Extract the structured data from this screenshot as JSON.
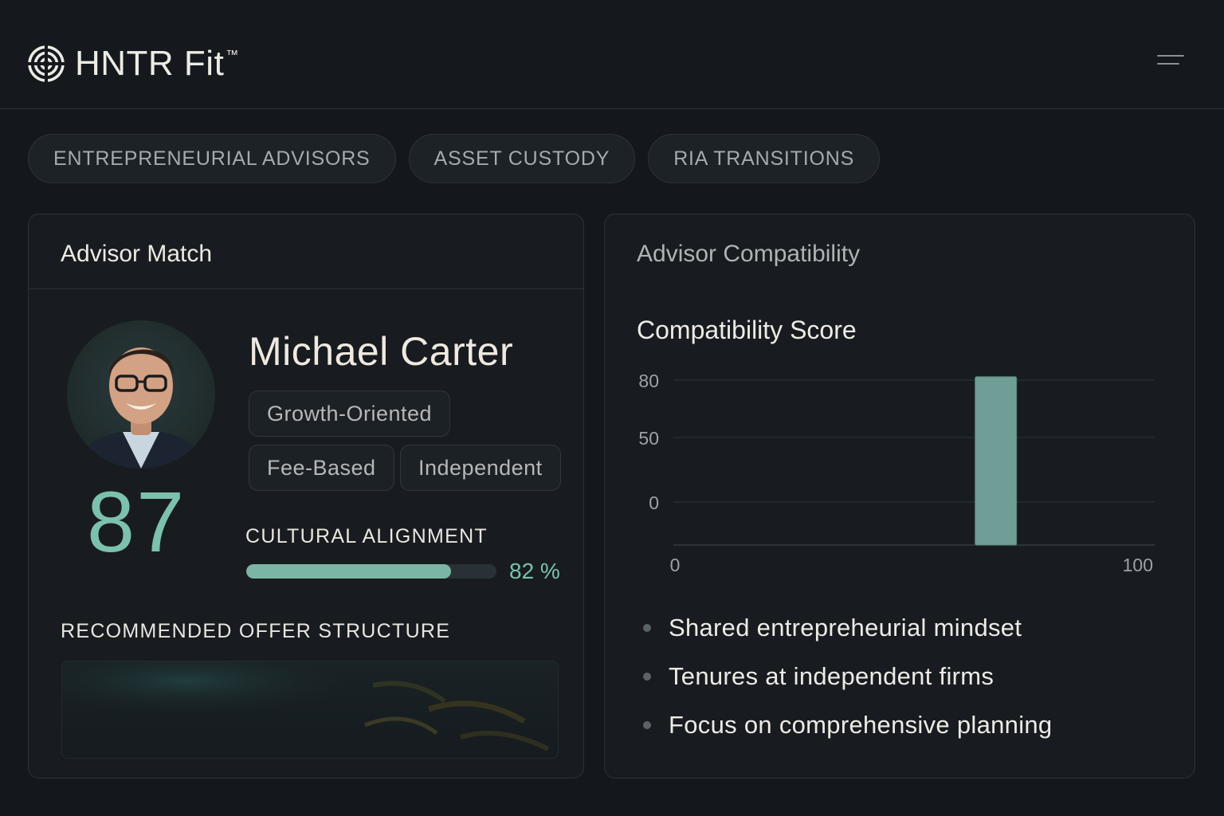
{
  "header": {
    "brand": "HNTR Fit",
    "trademark": "™",
    "logo_icon": "target-icon",
    "menu_icon": "menu-icon"
  },
  "tabs": [
    {
      "label": "ENTREPRENEURIAL ADVISORS"
    },
    {
      "label": "ASSET CUSTODY"
    },
    {
      "label": "RIA TRANSITIONS"
    }
  ],
  "advisor_match": {
    "title": "Advisor Match",
    "name": "Michael Carter",
    "score": "87",
    "tags": [
      "Growth-Oriented",
      "Fee-Based",
      "Independent"
    ],
    "cultural_alignment": {
      "label": "CULTURAL ALIGNMENT",
      "value_text": "82 %",
      "value": 0.82
    },
    "offer_label": "RECOMMENDED OFFER STRUCTURE"
  },
  "compatibility": {
    "title": "Advisor Compatibility",
    "bullets": [
      "Shared entrepreheurial mindset",
      "Tenures at independent firms",
      "Focus on comprehensive planning"
    ]
  },
  "chart_data": {
    "type": "bar",
    "title": "Compatibility Score",
    "y_ticks": [
      "80",
      "50",
      "0"
    ],
    "x_ticks": [
      "0",
      "100"
    ],
    "xlim": [
      0,
      100
    ],
    "bars": [
      {
        "x": 67,
        "value": 87
      }
    ],
    "grid": true,
    "bar_color": "#6f9e97"
  },
  "colors": {
    "accent": "#7cc1ad",
    "background": "#14181c",
    "card": "#181c20"
  }
}
